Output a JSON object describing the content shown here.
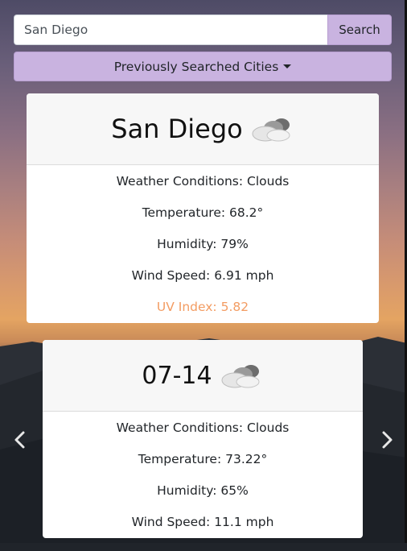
{
  "search": {
    "value": "San Diego",
    "button_label": "Search"
  },
  "history": {
    "button_label": "Previously Searched Cities"
  },
  "current": {
    "city": "San Diego",
    "icon": "cloud-icon",
    "conditions": "Weather Conditions: Clouds",
    "temperature": "Temperature: 68.2°",
    "humidity": "Humidity: 79%",
    "wind": "Wind Speed: 6.91 mph",
    "uv": "UV Index: 5.82",
    "uv_color": "#f39c62"
  },
  "forecast": {
    "date": "07-14",
    "icon": "cloud-icon",
    "conditions": "Weather Conditions: Clouds",
    "temperature": "Temperature: 73.22°",
    "humidity": "Humidity: 65%",
    "wind": "Wind Speed: 11.1 mph"
  },
  "colors": {
    "button_bg": "#c9b3e0",
    "card_header_bg": "#f7f7f7"
  }
}
